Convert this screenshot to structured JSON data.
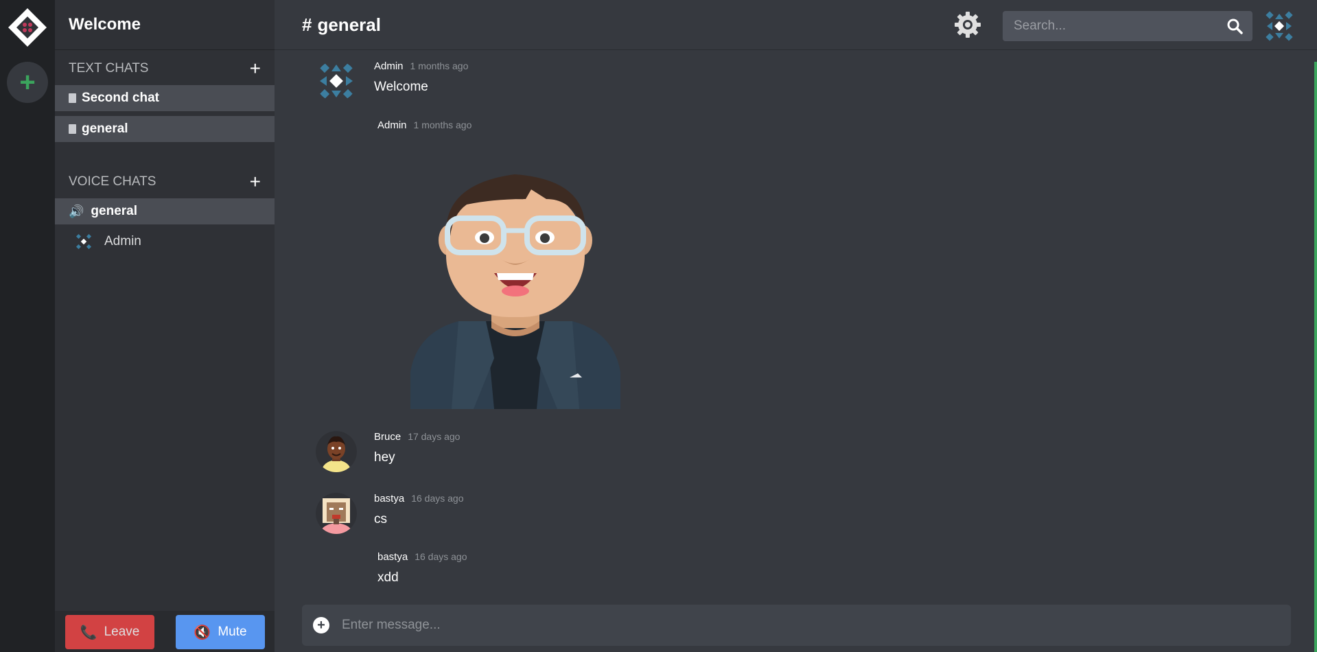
{
  "server": {
    "name": "Welcome"
  },
  "rail": {
    "add_server_label": "+"
  },
  "sidebar": {
    "text_category": "TEXT CHATS",
    "voice_category": "VOICE CHATS",
    "add_label": "+",
    "text_channels": [
      "Second chat",
      "general"
    ],
    "voice_channels": [
      "general"
    ],
    "voice_users": [
      "Admin"
    ]
  },
  "voice": {
    "leave_label": "Leave",
    "mute_label": "Mute"
  },
  "header": {
    "hash": "#",
    "channel": "general",
    "search_placeholder": "Search..."
  },
  "messages": [
    {
      "author": "Admin",
      "time": "1 months ago",
      "text": "Welcome"
    },
    {
      "author": "Admin",
      "time": "1 months ago",
      "text": ""
    },
    {
      "author": "Bruce",
      "time": "17 days ago",
      "text": "hey"
    },
    {
      "author": "bastya",
      "time": "16 days ago",
      "text": "cs"
    },
    {
      "author": "bastya",
      "time": "16 days ago",
      "text": "xdd"
    }
  ],
  "composer": {
    "add_label": "+",
    "placeholder": "Enter message..."
  },
  "colors": {
    "accent_green": "#3ba55d",
    "leave_red": "#f04747",
    "mute_blue": "#5896f0",
    "background": "#36393f"
  }
}
